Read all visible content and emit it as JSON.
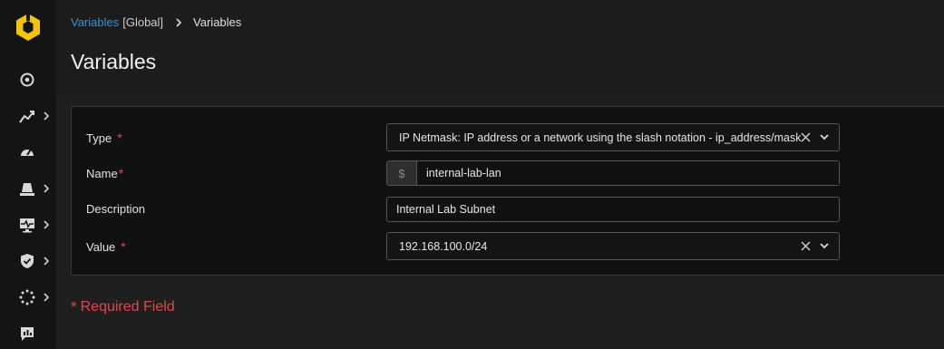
{
  "breadcrumb": {
    "link": "Variables",
    "scope": "[Global]",
    "current": "Variables"
  },
  "page": {
    "title": "Variables"
  },
  "sidebar": {
    "items": [
      {
        "icon": "target-icon",
        "has_submenu": false
      },
      {
        "icon": "analytics-icon",
        "has_submenu": true
      },
      {
        "icon": "dashboard-gauge-icon",
        "has_submenu": false
      },
      {
        "icon": "alarm-icon",
        "has_submenu": true
      },
      {
        "icon": "monitor-pulse-icon",
        "has_submenu": true
      },
      {
        "icon": "shield-check-icon",
        "has_submenu": true
      },
      {
        "icon": "settings-dots-icon",
        "has_submenu": true
      },
      {
        "icon": "report-icon",
        "has_submenu": false
      }
    ]
  },
  "form": {
    "type": {
      "label": "Type",
      "required_mark": "*",
      "value": "IP Netmask: IP address or a network using the slash notation - ip_address/mask"
    },
    "name": {
      "label": "Name",
      "required_mark": "*",
      "prefix": "$",
      "value": "internal-lab-lan"
    },
    "description": {
      "label": "Description",
      "value": "Internal Lab Subnet"
    },
    "value": {
      "label": "Value",
      "required_mark": "*",
      "value": "192.168.100.0/24"
    },
    "required_note": {
      "mark": "*",
      "text": "Required Field"
    }
  },
  "colors": {
    "accent_link": "#3e8ed0",
    "required": "#e0474c",
    "logo": "#f5c400",
    "sidebar_bg": "#141414",
    "page_bg": "#1c1c1c"
  }
}
